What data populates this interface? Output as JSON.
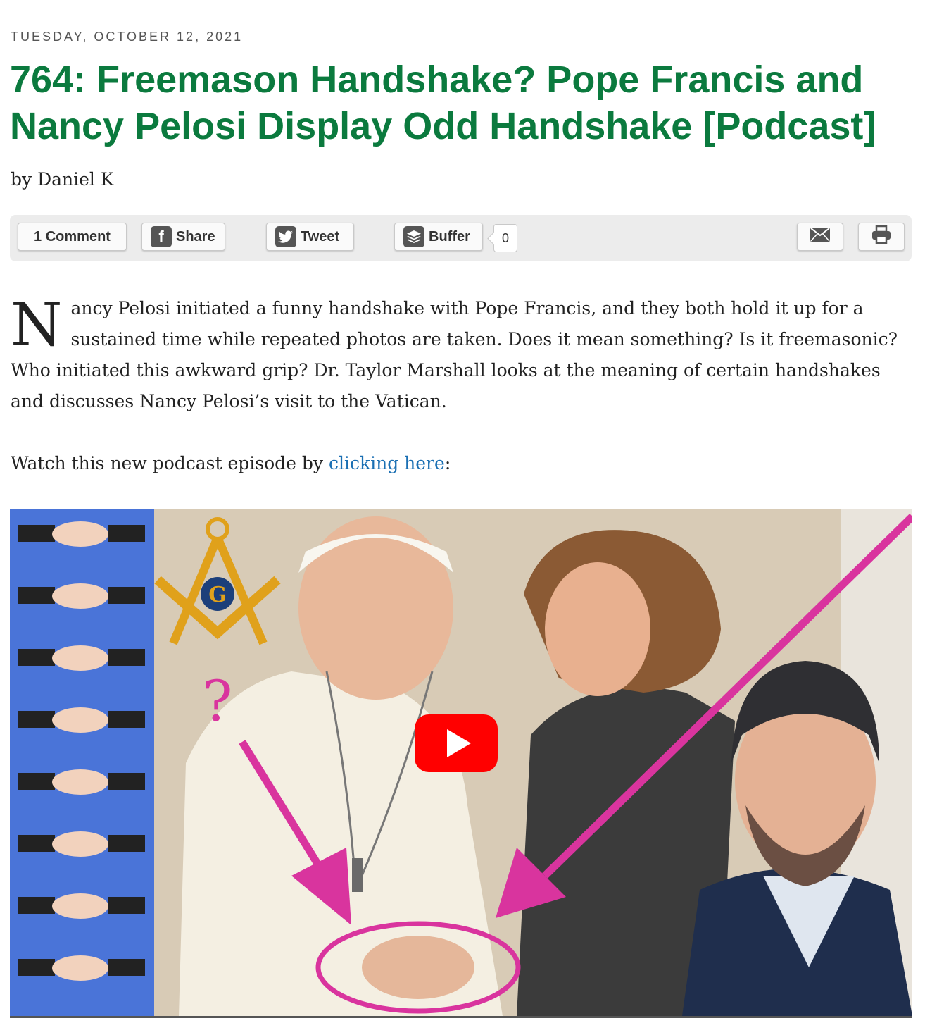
{
  "post": {
    "date": "Tuesday, October 12, 2021",
    "title": "764: Freemason Handshake? Pope Francis and Nancy Pelosi Display Odd Handshake [Podcast]",
    "byline": "by Daniel K"
  },
  "sharebar": {
    "comments_label": "1 Comment",
    "share_label": "Share",
    "tweet_label": "Tweet",
    "buffer_label": "Buffer",
    "buffer_count": "0",
    "icons": [
      "facebook-icon",
      "twitter-icon",
      "buffer-icon",
      "mail-icon",
      "print-icon"
    ]
  },
  "article": {
    "dropcap": "N",
    "paragraph": "ancy Pelosi initiated a funny handshake with Pope Francis, and they both hold it up for a sustained time while repeated photos are taken. Does it mean something? Is it freemasonic? Who initiated this awkward grip? Dr. Taylor Marshall looks at the meaning of certain handshakes and discusses Nancy Pelosi’s visit to the Vatican.",
    "watch_prefix": "Watch this new podcast episode by ",
    "watch_link": "clicking here",
    "watch_suffix": ":"
  },
  "video": {
    "thumbnail_symbol": "G",
    "question_mark": "?",
    "play_icon": "youtube-play-icon",
    "colors": {
      "arrow": "#d9349e",
      "left_panel": "#4a74d8",
      "play": "#ff0000"
    }
  }
}
